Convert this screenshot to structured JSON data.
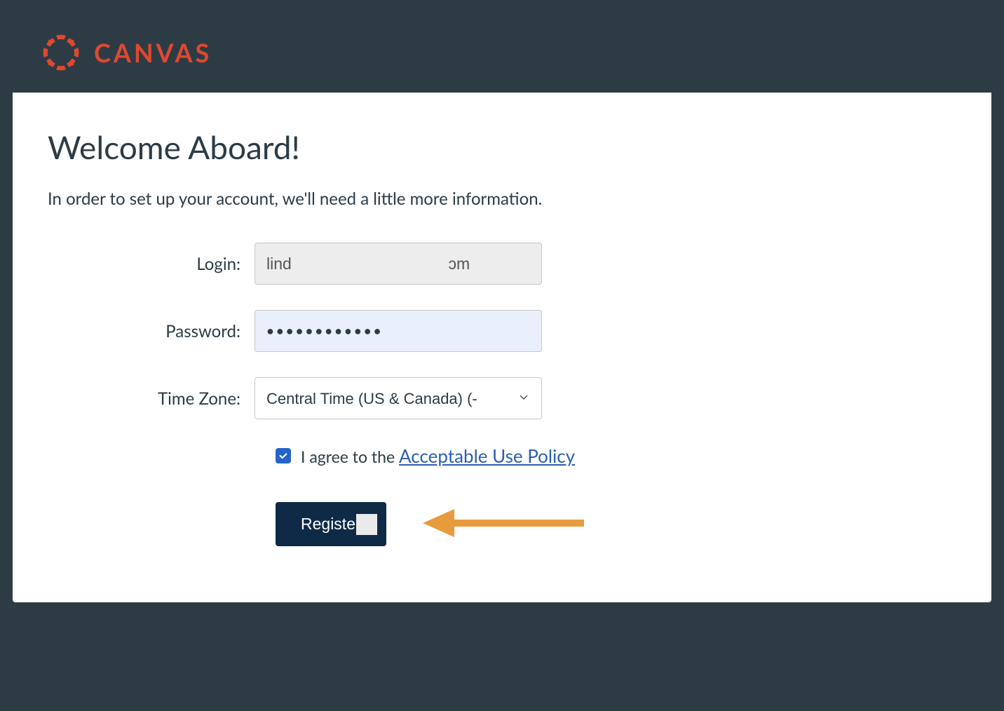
{
  "brand": {
    "name": "CANVAS"
  },
  "page": {
    "title": "Welcome Aboard!",
    "subtitle": "In order to set up your account, we'll need a little more information."
  },
  "form": {
    "login": {
      "label": "Login:",
      "value": "lind                                   ɔm"
    },
    "password": {
      "label": "Password:",
      "value": "●●●●●●●●●●●●"
    },
    "timezone": {
      "label": "Time Zone:",
      "selected": "Central Time (US & Canada) (-"
    },
    "agreement": {
      "checked": true,
      "prefix": "I agree to the ",
      "link_text": "Acceptable Use Policy"
    },
    "submit": {
      "label": "Register"
    }
  }
}
